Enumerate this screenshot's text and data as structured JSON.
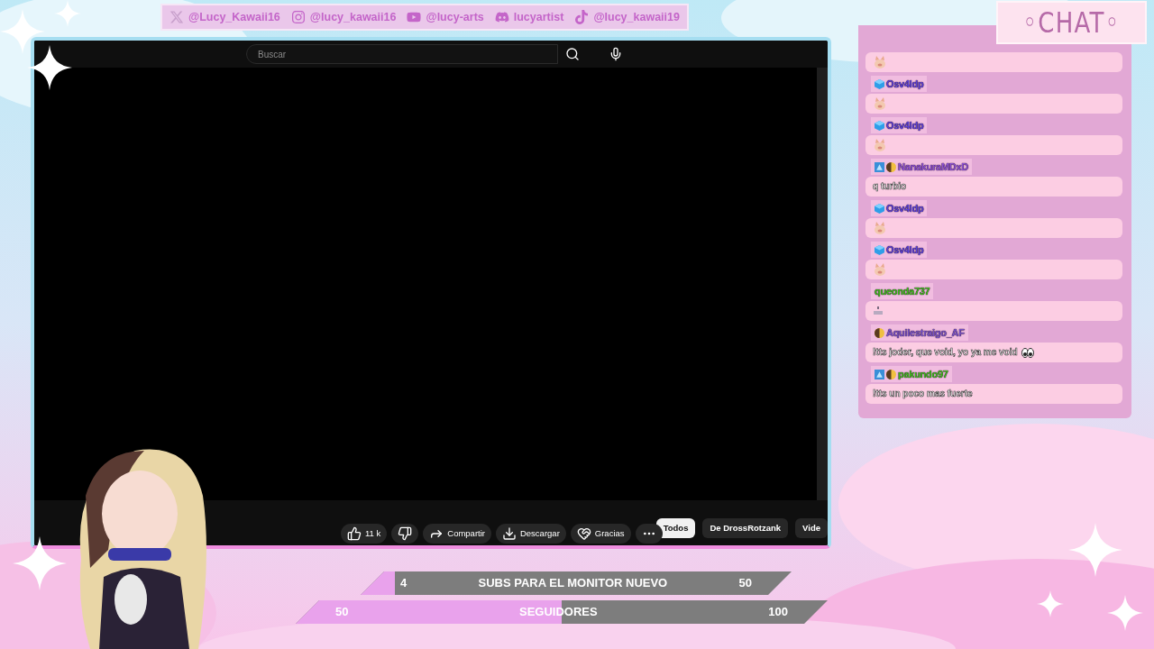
{
  "social_links": [
    {
      "kind": "x",
      "handle": "@Lucy_Kawaii16"
    },
    {
      "kind": "instagram",
      "handle": "@lucy_kawaii16"
    },
    {
      "kind": "youtube",
      "handle": "@lucy-arts"
    },
    {
      "kind": "discord",
      "handle": "lucyartist"
    },
    {
      "kind": "tiktok",
      "handle": "@lucy_kawaii19"
    }
  ],
  "browser": {
    "search": {
      "placeholder": "Buscar"
    },
    "actions": [
      {
        "kind": "like",
        "label": "11 k"
      },
      {
        "kind": "dislike"
      },
      {
        "kind": "share",
        "label": "Compartir"
      },
      {
        "kind": "download",
        "label": "Descargar"
      },
      {
        "kind": "thanks",
        "label": "Gracias"
      },
      {
        "kind": "more"
      }
    ],
    "chips": [
      {
        "label": "Todos",
        "selected": true
      },
      {
        "label": "De DrossRotzank",
        "selected": false
      },
      {
        "label": "Vide",
        "selected": false
      }
    ]
  },
  "chat": {
    "title": "◦CHAT◦",
    "messages": [
      {
        "kind": "emote"
      },
      {
        "kind": "emote",
        "user": "Osv4ldp",
        "color": "#5a3fd4",
        "badges": [
          {
            "kind": "cube"
          }
        ]
      },
      {
        "kind": "emote",
        "user": "Osv4ldp",
        "color": "#5a3fd4",
        "badges": [
          {
            "kind": "cube"
          }
        ]
      },
      {
        "kind": "text",
        "user": "NanakuraMDxD",
        "color": "#8a4fd0",
        "badges": [
          {
            "kind": "sub"
          },
          {
            "kind": "moon"
          }
        ],
        "text": "q turbio",
        "end_emote": false
      },
      {
        "kind": "emote",
        "user": "Osv4ldp",
        "color": "#5a3fd4",
        "badges": [
          {
            "kind": "cube"
          }
        ]
      },
      {
        "kind": "emote",
        "user": "Osv4ldp",
        "color": "#5a3fd4",
        "badges": [
          {
            "kind": "cube"
          }
        ]
      },
      {
        "kind": "small_emote",
        "user": "queonda737",
        "color": "#3fb81c"
      },
      {
        "kind": "text",
        "user": "Aquilestraigo_AF",
        "color": "#7650c4",
        "badges": [
          {
            "kind": "moon"
          }
        ],
        "text": "!tts joder, que void, yo ya me void",
        "end_emote": true
      },
      {
        "kind": "text",
        "user": "pakundo97",
        "color": "#3fb81c",
        "badges": [
          {
            "kind": "sub"
          },
          {
            "kind": "moon"
          }
        ],
        "text": "!tts un poco mas fuerte",
        "end_emote": false
      }
    ]
  },
  "goals": [
    {
      "current": "4",
      "label": "SUBS PARA EL MONITOR NUEVO",
      "target": "50",
      "level": 0.08
    },
    {
      "current": "50",
      "label": "SEGUIDORES",
      "target": "100",
      "level": 0.5
    }
  ]
}
